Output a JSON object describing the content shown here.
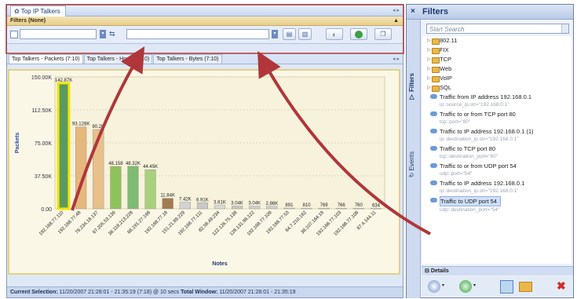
{
  "left_window": {
    "tab_title": "Top IP Talkers",
    "filters_label": "Filters (None)",
    "tabs": [
      {
        "label": "Top Talkers - Packets (7:10)",
        "active": true
      },
      {
        "label": "Top Talkers - Hosts (7:10)",
        "active": false
      },
      {
        "label": "Top Talkers - Bytes (7:10)",
        "active": false
      }
    ],
    "status_label": "Current Selection:",
    "status_value": "11/20/2007 21:28:01 - 21:35:19 (7:18) @ 10 secs",
    "status_total_label": "Total Window:",
    "status_total_value": "11/20/2007 21:28:01 - 21:35:19"
  },
  "chart_data": {
    "type": "bar",
    "ylabel": "Packets",
    "xlabel": "Notes",
    "ylim": [
      0,
      150000
    ],
    "yticks": [
      "150.00K",
      "112.50K",
      "75.00K",
      "37.50K",
      "0.00"
    ],
    "categories": [
      "192.168.77.110",
      "192.168.77.48",
      "76.234.18.137",
      "67.205.53.139",
      "38.118.213.228",
      "66.191.27.168",
      "192.168.77.18",
      "151.21.89.229",
      "192.168.77.111",
      "82.58.49.234",
      "122.126.75.138",
      "128.131.96.122",
      "192.168.77.109",
      "192.168.77.53",
      "64.7.210.162",
      "38.107.164.19",
      "192.168.77.103",
      "192.168.77.108",
      "87.4.144.11"
    ],
    "values": [
      142870,
      93128,
      90200,
      48158,
      48320,
      44450,
      11840,
      7420,
      6910,
      3810,
      3040,
      3040,
      2860,
      891,
      810,
      769,
      766,
      760,
      634
    ],
    "labels": [
      "142.87K",
      "93.128K",
      "90.2K",
      "48.158",
      "48.32K",
      "44.45K",
      "11.84K",
      "7.42K",
      "6.91K",
      "3.81K",
      "3.04K",
      "3.04K",
      "2.86K",
      "891",
      "810",
      "769",
      "766",
      "760",
      "634"
    ],
    "colors": [
      "#5a9a5e",
      "#e6b87d",
      "#e8c08a",
      "#8fc25a",
      "#7fbb72",
      "#a9d07c",
      "#a47a52",
      "#d3d3d3",
      "#c9c9c9",
      "#d8d8d8",
      "#c7c7c7",
      "#d0d0d0",
      "#cfcfcf",
      "#cccccc",
      "#d1d1d1",
      "#cecece",
      "#d2d2d2",
      "#cbcbcb",
      "#d4d4d4"
    ],
    "selected_index": 0
  },
  "right_panel": {
    "title": "Filters",
    "side_tabs": [
      "Filters",
      "Events"
    ],
    "search_placeholder": "Start Search",
    "folders": [
      "802.11",
      "FIX",
      "TCP",
      "Web",
      "VoIP",
      "SQL"
    ],
    "filters": [
      {
        "name": "Traffic from IP address 192.168.0.1",
        "expr": "ip::source_ip.str=\"192.168.0.1\""
      },
      {
        "name": "Traffic to or from TCP port 80",
        "expr": "tcp::port=\"80\""
      },
      {
        "name": "Traffic to IP address 192.168.0.1 (1)",
        "expr": "ip::destination_ip.str=\"192.168.0.1\""
      },
      {
        "name": "Traffic to TCP port 80",
        "expr": "tcp::destination_port=\"80\""
      },
      {
        "name": "Traffic to or from UDP port 54",
        "expr": "udp::port=\"54\""
      },
      {
        "name": "Traffic to IP address 192.168.0.1",
        "expr": "ip::destination_ip.str=\"192.168.0.1\""
      },
      {
        "name": "Traffic to UDP port 54",
        "expr": "udp::destination_port=\"54\"",
        "selected": true
      }
    ],
    "details_label": "Details"
  },
  "colors": {
    "arrow": "#b0363b",
    "panel_border": "#8a9bbf",
    "filters_bar": "#e8cf8a"
  }
}
